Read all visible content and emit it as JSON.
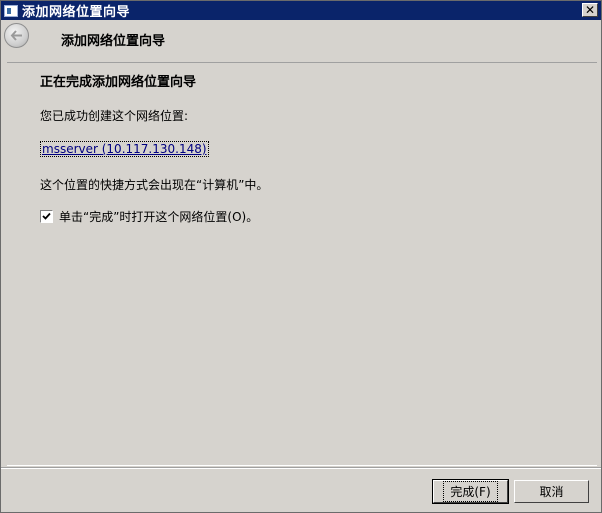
{
  "window": {
    "title": "添加网络位置向导",
    "close_label": "✕",
    "icons": [
      "window-icon",
      "close-icon"
    ]
  },
  "header": {
    "title": "添加网络位置向导",
    "back_icon": "back-arrow-icon"
  },
  "content": {
    "heading": "正在完成添加网络位置向导",
    "success_text": "您已成功创建这个网络位置:",
    "location_link": "msserver (10.117.130.148)",
    "shortcut_text": "这个位置的快捷方式会出现在“计算机”中。",
    "open_checkbox": {
      "label": "单击“完成”时打开这个网络位置(O)。",
      "checked": true
    }
  },
  "buttons": {
    "finish": "完成(F)",
    "cancel": "取消"
  },
  "colors": {
    "titlebar": "#0a246a",
    "background": "#d6d3ce",
    "link": "#000080"
  }
}
